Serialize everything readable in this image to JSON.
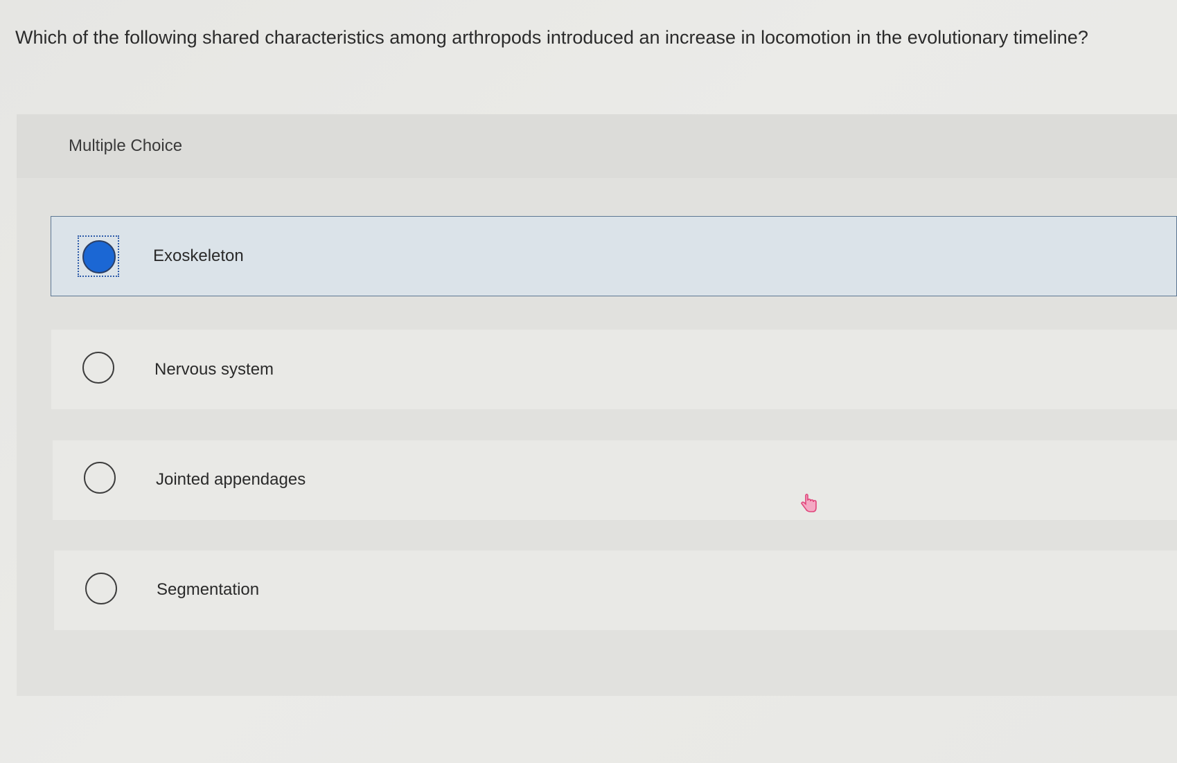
{
  "question": {
    "text": "Which of the following shared characteristics among arthropods introduced an increase in locomotion in the evolutionary timeline?"
  },
  "panel": {
    "title": "Multiple Choice"
  },
  "options": [
    {
      "label": "Exoskeleton",
      "selected": true
    },
    {
      "label": "Nervous system",
      "selected": false
    },
    {
      "label": "Jointed appendages",
      "selected": false
    },
    {
      "label": "Segmentation",
      "selected": false
    }
  ],
  "colors": {
    "selected_fill": "#1b67d4",
    "selected_border": "#5c7692",
    "cursor": "#e0457b"
  },
  "icons": {
    "cursor": "hand-pointer-icon"
  }
}
